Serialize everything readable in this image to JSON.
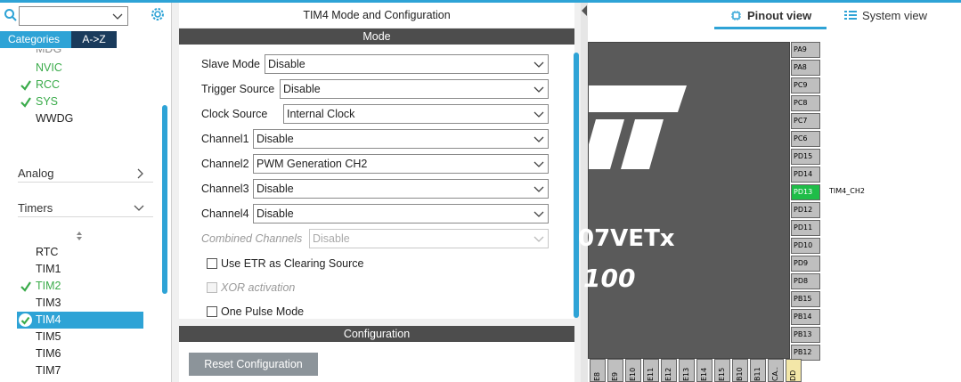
{
  "left_panel": {
    "search": {
      "value": "",
      "placeholder": ""
    },
    "tabs": {
      "categories": "Categories",
      "az": "A->Z"
    },
    "system_items": [
      {
        "label": "NVIC",
        "ok": false
      },
      {
        "label": "RCC",
        "ok": true
      },
      {
        "label": "SYS",
        "ok": true
      },
      {
        "label": "WWDG",
        "ok": false
      }
    ],
    "partial_top": "MDG",
    "categories": {
      "analog": "Analog",
      "timers": "Timers"
    },
    "timer_items": [
      {
        "label": "RTC",
        "ok": false
      },
      {
        "label": "TIM1",
        "ok": false
      },
      {
        "label": "TIM2",
        "ok": true
      },
      {
        "label": "TIM3",
        "ok": false
      },
      {
        "label": "TIM4",
        "ok": true,
        "selected": true
      },
      {
        "label": "TIM5",
        "ok": false
      },
      {
        "label": "TIM6",
        "ok": false
      },
      {
        "label": "TIM7",
        "ok": false
      }
    ]
  },
  "middle_panel": {
    "title": "TIM4 Mode and Configuration",
    "mode_header": "Mode",
    "fields": [
      {
        "label": "Slave Mode",
        "value": "Disable"
      },
      {
        "label": "Trigger Source",
        "value": "Disable"
      },
      {
        "label": "Clock Source",
        "value": "Internal Clock"
      },
      {
        "label": "Channel1",
        "value": "Disable"
      },
      {
        "label": "Channel2",
        "value": "PWM Generation CH2"
      },
      {
        "label": "Channel3",
        "value": "Disable"
      },
      {
        "label": "Channel4",
        "value": "Disable"
      },
      {
        "label": "Combined Channels",
        "value": "Disable",
        "disabled": true
      }
    ],
    "checkboxes": [
      {
        "label": "Use ETR as Clearing Source",
        "checked": false,
        "disabled": false
      },
      {
        "label": "XOR activation",
        "checked": false,
        "disabled": true
      },
      {
        "label": "One Pulse Mode",
        "checked": false,
        "disabled": false
      }
    ],
    "config_header": "Configuration",
    "reset_button": "Reset Configuration"
  },
  "right_panel": {
    "tabs": {
      "pinout": "Pinout view",
      "system": "System view"
    },
    "chip_text_1": "07VETx",
    "chip_text_2": "100",
    "right_pins": [
      "PA9",
      "PA8",
      "PC9",
      "PC8",
      "PC7",
      "PC6",
      "PD15",
      "PD14",
      "PD13",
      "PD12",
      "PD11",
      "PD10",
      "PD9",
      "PD8",
      "PB15",
      "PB14",
      "PB13",
      "PB12"
    ],
    "highlighted_pin": "PD13",
    "pin_signal": "TIM4_CH2",
    "bottom_pins": [
      "E8",
      "E9",
      "E10",
      "E11",
      "E12",
      "E13",
      "E14",
      "E15",
      "B10",
      "B11",
      "CA..",
      "DD"
    ],
    "colors": {
      "accent": "#2ea3d6",
      "pin_green": "#1fbd48",
      "chip": "#5a5a5a"
    }
  }
}
